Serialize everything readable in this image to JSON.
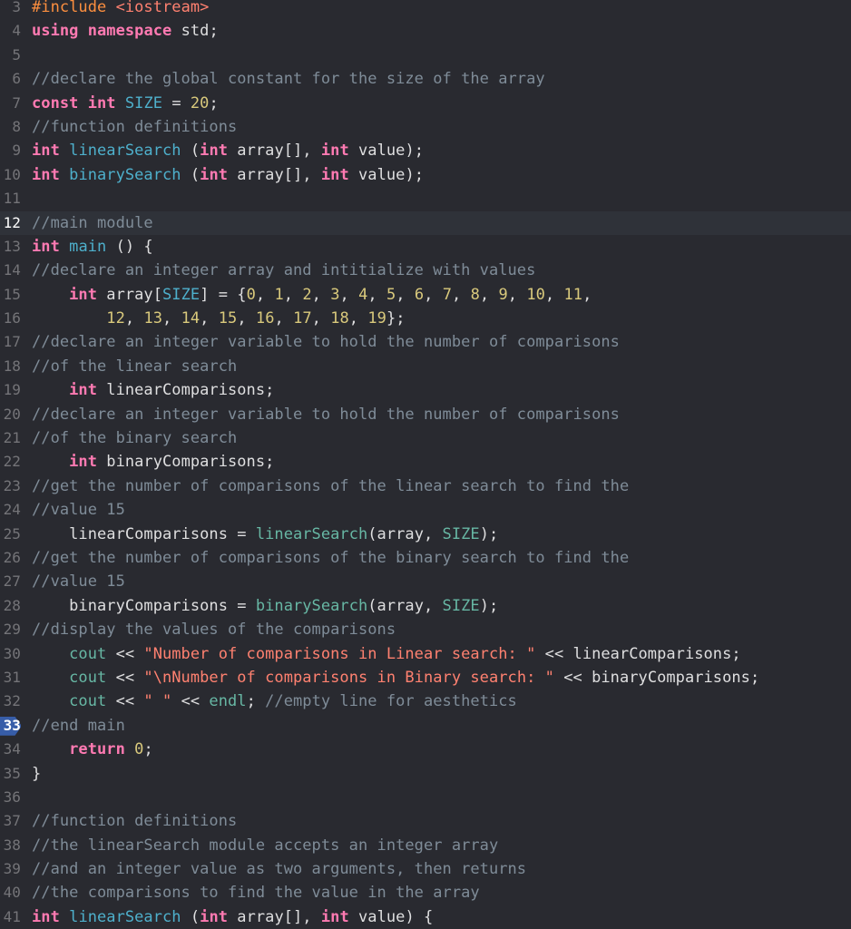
{
  "editor": {
    "current_line": "12",
    "breakpoint_line": "33",
    "lines": [
      {
        "n": "3",
        "tokens": [
          {
            "t": "#include ",
            "c": "pp"
          },
          {
            "t": "<iostream>",
            "c": "incl"
          }
        ]
      },
      {
        "n": "4",
        "tokens": [
          {
            "t": "using",
            "c": "kw"
          },
          {
            "t": " "
          },
          {
            "t": "namespace",
            "c": "kw"
          },
          {
            "t": " std;"
          }
        ]
      },
      {
        "n": "5",
        "tokens": []
      },
      {
        "n": "6",
        "tokens": [
          {
            "t": "//declare the global constant for the size of the array",
            "c": "cm"
          }
        ]
      },
      {
        "n": "7",
        "tokens": [
          {
            "t": "const",
            "c": "kw"
          },
          {
            "t": " "
          },
          {
            "t": "int",
            "c": "kw"
          },
          {
            "t": " "
          },
          {
            "t": "SIZE",
            "c": "fn"
          },
          {
            "t": " = "
          },
          {
            "t": "20",
            "c": "num"
          },
          {
            "t": ";"
          }
        ]
      },
      {
        "n": "8",
        "tokens": [
          {
            "t": "//function definitions",
            "c": "cm"
          }
        ]
      },
      {
        "n": "9",
        "tokens": [
          {
            "t": "int",
            "c": "kw"
          },
          {
            "t": " "
          },
          {
            "t": "linearSearch",
            "c": "fn"
          },
          {
            "t": " ("
          },
          {
            "t": "int",
            "c": "kw"
          },
          {
            "t": " array[], "
          },
          {
            "t": "int",
            "c": "kw"
          },
          {
            "t": " value);"
          }
        ]
      },
      {
        "n": "10",
        "tokens": [
          {
            "t": "int",
            "c": "kw"
          },
          {
            "t": " "
          },
          {
            "t": "binarySearch",
            "c": "fn"
          },
          {
            "t": " ("
          },
          {
            "t": "int",
            "c": "kw"
          },
          {
            "t": " array[], "
          },
          {
            "t": "int",
            "c": "kw"
          },
          {
            "t": " value);"
          }
        ]
      },
      {
        "n": "11",
        "tokens": []
      },
      {
        "n": "12",
        "tokens": [
          {
            "t": "//main module",
            "c": "cm"
          }
        ]
      },
      {
        "n": "13",
        "tokens": [
          {
            "t": "int",
            "c": "kw"
          },
          {
            "t": " "
          },
          {
            "t": "main",
            "c": "fn"
          },
          {
            "t": " () {"
          }
        ]
      },
      {
        "n": "14",
        "tokens": [
          {
            "t": "//declare an integer array and intitialize with values",
            "c": "cm"
          }
        ]
      },
      {
        "n": "15",
        "tokens": [
          {
            "t": "    "
          },
          {
            "t": "int",
            "c": "kw"
          },
          {
            "t": " array["
          },
          {
            "t": "SIZE",
            "c": "fn"
          },
          {
            "t": "] = {"
          },
          {
            "t": "0",
            "c": "num"
          },
          {
            "t": ", "
          },
          {
            "t": "1",
            "c": "num"
          },
          {
            "t": ", "
          },
          {
            "t": "2",
            "c": "num"
          },
          {
            "t": ", "
          },
          {
            "t": "3",
            "c": "num"
          },
          {
            "t": ", "
          },
          {
            "t": "4",
            "c": "num"
          },
          {
            "t": ", "
          },
          {
            "t": "5",
            "c": "num"
          },
          {
            "t": ", "
          },
          {
            "t": "6",
            "c": "num"
          },
          {
            "t": ", "
          },
          {
            "t": "7",
            "c": "num"
          },
          {
            "t": ", "
          },
          {
            "t": "8",
            "c": "num"
          },
          {
            "t": ", "
          },
          {
            "t": "9",
            "c": "num"
          },
          {
            "t": ", "
          },
          {
            "t": "10",
            "c": "num"
          },
          {
            "t": ", "
          },
          {
            "t": "11",
            "c": "num"
          },
          {
            "t": ","
          }
        ]
      },
      {
        "n": "16",
        "tokens": [
          {
            "t": "        "
          },
          {
            "t": "12",
            "c": "num"
          },
          {
            "t": ", "
          },
          {
            "t": "13",
            "c": "num"
          },
          {
            "t": ", "
          },
          {
            "t": "14",
            "c": "num"
          },
          {
            "t": ", "
          },
          {
            "t": "15",
            "c": "num"
          },
          {
            "t": ", "
          },
          {
            "t": "16",
            "c": "num"
          },
          {
            "t": ", "
          },
          {
            "t": "17",
            "c": "num"
          },
          {
            "t": ", "
          },
          {
            "t": "18",
            "c": "num"
          },
          {
            "t": ", "
          },
          {
            "t": "19",
            "c": "num"
          },
          {
            "t": "};"
          }
        ]
      },
      {
        "n": "17",
        "tokens": [
          {
            "t": "//declare an integer variable to hold the number of comparisons",
            "c": "cm"
          }
        ]
      },
      {
        "n": "18",
        "tokens": [
          {
            "t": "//of the linear search",
            "c": "cm"
          }
        ]
      },
      {
        "n": "19",
        "tokens": [
          {
            "t": "    "
          },
          {
            "t": "int",
            "c": "kw"
          },
          {
            "t": " linearComparisons;"
          }
        ]
      },
      {
        "n": "20",
        "tokens": [
          {
            "t": "//declare an integer variable to hold the number of comparisons",
            "c": "cm"
          }
        ]
      },
      {
        "n": "21",
        "tokens": [
          {
            "t": "//of the binary search",
            "c": "cm"
          }
        ]
      },
      {
        "n": "22",
        "tokens": [
          {
            "t": "    "
          },
          {
            "t": "int",
            "c": "kw"
          },
          {
            "t": " binaryComparisons;"
          }
        ]
      },
      {
        "n": "23",
        "tokens": [
          {
            "t": "//get the number of comparisons of the linear search to find the",
            "c": "cm"
          }
        ]
      },
      {
        "n": "24",
        "tokens": [
          {
            "t": "//value 15",
            "c": "cm"
          }
        ]
      },
      {
        "n": "25",
        "tokens": [
          {
            "t": "    linearComparisons = "
          },
          {
            "t": "linearSearch",
            "c": "fnc"
          },
          {
            "t": "(array, "
          },
          {
            "t": "SIZE",
            "c": "fnc"
          },
          {
            "t": ");"
          }
        ]
      },
      {
        "n": "26",
        "tokens": [
          {
            "t": "//get the number of comparisons of the binary search to find the",
            "c": "cm"
          }
        ]
      },
      {
        "n": "27",
        "tokens": [
          {
            "t": "//value 15",
            "c": "cm"
          }
        ]
      },
      {
        "n": "28",
        "tokens": [
          {
            "t": "    binaryComparisons = "
          },
          {
            "t": "binarySearch",
            "c": "fnc"
          },
          {
            "t": "(array, "
          },
          {
            "t": "SIZE",
            "c": "fnc"
          },
          {
            "t": ");"
          }
        ]
      },
      {
        "n": "29",
        "tokens": [
          {
            "t": "//display the values of the comparisons",
            "c": "cm"
          }
        ]
      },
      {
        "n": "30",
        "tokens": [
          {
            "t": "    "
          },
          {
            "t": "cout",
            "c": "fnc"
          },
          {
            "t": " << "
          },
          {
            "t": "\"Number of comparisons in Linear search: \"",
            "c": "str"
          },
          {
            "t": " << linearComparisons;"
          }
        ]
      },
      {
        "n": "31",
        "tokens": [
          {
            "t": "    "
          },
          {
            "t": "cout",
            "c": "fnc"
          },
          {
            "t": " << "
          },
          {
            "t": "\"\\nNumber of comparisons in Binary search: \"",
            "c": "str"
          },
          {
            "t": " << binaryComparisons;"
          }
        ]
      },
      {
        "n": "32",
        "tokens": [
          {
            "t": "    "
          },
          {
            "t": "cout",
            "c": "fnc"
          },
          {
            "t": " << "
          },
          {
            "t": "\" \"",
            "c": "str"
          },
          {
            "t": " << "
          },
          {
            "t": "endl",
            "c": "fnc"
          },
          {
            "t": "; "
          },
          {
            "t": "//empty line for aesthetics",
            "c": "cm"
          }
        ]
      },
      {
        "n": "33",
        "tokens": [
          {
            "t": "//end main",
            "c": "cm"
          }
        ]
      },
      {
        "n": "34",
        "tokens": [
          {
            "t": "    "
          },
          {
            "t": "return",
            "c": "kw"
          },
          {
            "t": " "
          },
          {
            "t": "0",
            "c": "num"
          },
          {
            "t": ";"
          }
        ]
      },
      {
        "n": "35",
        "tokens": [
          {
            "t": "}"
          }
        ]
      },
      {
        "n": "36",
        "tokens": []
      },
      {
        "n": "37",
        "tokens": [
          {
            "t": "//function definitions",
            "c": "cm"
          }
        ]
      },
      {
        "n": "38",
        "tokens": [
          {
            "t": "//the linearSearch module accepts an integer array",
            "c": "cm"
          }
        ]
      },
      {
        "n": "39",
        "tokens": [
          {
            "t": "//and an integer value as two arguments, then returns",
            "c": "cm"
          }
        ]
      },
      {
        "n": "40",
        "tokens": [
          {
            "t": "//the comparisons to find the value in the array",
            "c": "cm"
          }
        ]
      },
      {
        "n": "41",
        "tokens": [
          {
            "t": "int",
            "c": "kw"
          },
          {
            "t": " "
          },
          {
            "t": "linearSearch",
            "c": "fn"
          },
          {
            "t": " ("
          },
          {
            "t": "int",
            "c": "kw"
          },
          {
            "t": " array[], "
          },
          {
            "t": "int",
            "c": "kw"
          },
          {
            "t": " value) {"
          }
        ]
      }
    ]
  }
}
